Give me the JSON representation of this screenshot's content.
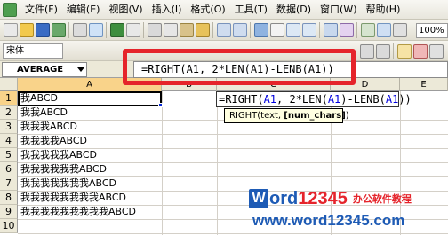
{
  "menu": [
    "文件(F)",
    "编辑(E)",
    "视图(V)",
    "插入(I)",
    "格式(O)",
    "工具(T)",
    "数据(D)",
    "窗口(W)",
    "帮助(H)"
  ],
  "toolbar": {
    "font_name": "宋体",
    "zoom": "100%"
  },
  "formula_bar": {
    "name_box": "AVERAGE",
    "formula": "=RIGHT(A1, 2*LEN(A1)-LENB(A1))"
  },
  "columns": [
    "A",
    "B",
    "C",
    "D",
    "E"
  ],
  "rows": [
    "1",
    "2",
    "3",
    "4",
    "5",
    "6",
    "7",
    "8",
    "9",
    "10"
  ],
  "cells_a": [
    "我ABCD",
    "我我ABCD",
    "我我我ABCD",
    "我我我我ABCD",
    "我我我我我ABCD",
    "我我我我我我ABCD",
    "我我我我我我我ABCD",
    "我我我我我我我我ABCD",
    "我我我我我我我我我ABCD",
    ""
  ],
  "cell_edit": {
    "p1": "=RIGHT(",
    "r1": "A1",
    "p2": ", 2*LEN(",
    "r2": "A1",
    "p3": ")-LENB(",
    "r3": "A1",
    "p4": "))"
  },
  "tooltip": {
    "prefix": "RIGHT(text, ",
    "arg": "[num_chars]",
    "suffix": ")"
  },
  "watermark": {
    "logo_w": "W",
    "logo_word": "ord",
    "logo_num": "12345",
    "logo_cn": "办公软件教程",
    "url": "www.word12345.com"
  },
  "colors": {
    "highlight": "#e5242b",
    "brand_blue": "#1e5bb5",
    "ref_blue": "#0000dd",
    "active_header": "#f9d38a"
  }
}
